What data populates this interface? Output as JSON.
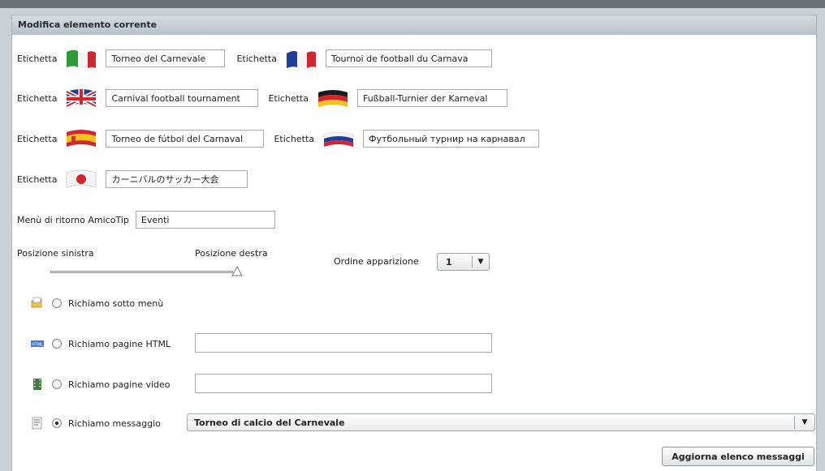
{
  "header": {
    "title": "Modifica elemento corrente"
  },
  "labels": [
    {
      "label": "Etichetta",
      "value": "Torneo del Carnevale",
      "flag": "italy-flag-icon"
    },
    {
      "label": "Etichetta",
      "value": "Tournoi de football du Carnava",
      "flag": "france-flag-icon"
    },
    {
      "label": "Etichetta",
      "value": "Carnival football tournament",
      "flag": "uk-flag-icon"
    },
    {
      "label": "Etichetta",
      "value": "Fußball-Turnier der Karneval",
      "flag": "germany-flag-icon"
    },
    {
      "label": "Etichetta",
      "value": "Torneo de fútbol del Carnaval",
      "flag": "spain-flag-icon"
    },
    {
      "label": "Etichetta",
      "value": "Футбольный турнир на карнавал",
      "flag": "russia-flag-icon"
    },
    {
      "label": "Etichetta",
      "value": "カーニバルのサッカー大会",
      "flag": "japan-flag-icon"
    }
  ],
  "return_menu": {
    "label": "Menù di ritorno AmicoTip",
    "value": "Eventi"
  },
  "slider": {
    "left_label": "Posizione sinistra",
    "right_label": "Posizione destra",
    "position": 1.0
  },
  "order": {
    "label": "Ordine apparizione",
    "value": "1"
  },
  "options": [
    {
      "label": "Richiamo sotto menù",
      "icon": "folder-icon",
      "checked": false
    },
    {
      "label": "Richiamo pagine HTML",
      "icon": "html-icon",
      "checked": false,
      "value": ""
    },
    {
      "label": "Richiamo pagine video",
      "icon": "film-icon",
      "checked": false,
      "value": ""
    },
    {
      "label": "Richiamo messaggio",
      "icon": "message-icon",
      "checked": true
    }
  ],
  "message_select": {
    "value": "Torneo di calcio del Carnevale"
  },
  "update_button": {
    "label": "Aggiorna elenco messaggi"
  },
  "colors": {
    "header_bg": "#c2cbd1",
    "frame": "#c9d1d7",
    "topbar": "#6b7278"
  }
}
